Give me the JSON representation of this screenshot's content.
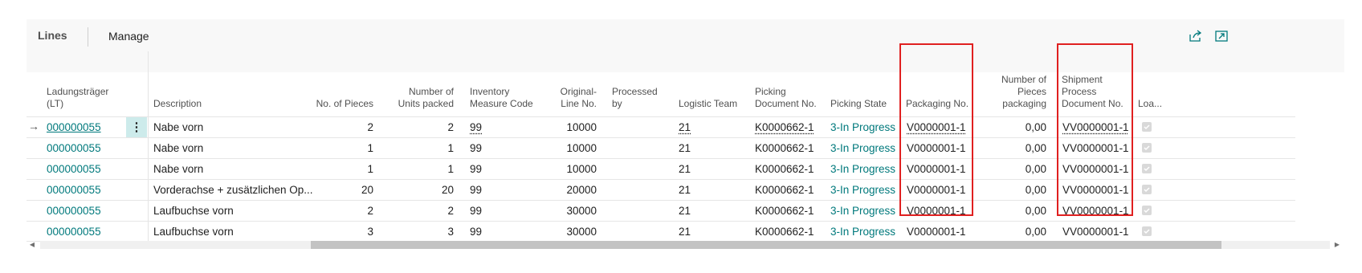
{
  "header": {
    "title": "Lines",
    "manage_label": "Manage",
    "share_icon": "share-icon",
    "expand_icon": "expand-icon"
  },
  "columns": {
    "lt": "Ladungsträger (LT)",
    "description": "Description",
    "no_pieces": "No. of Pieces",
    "units_packed": "Number of Units packed",
    "inv_measure": "Inventory Measure Code",
    "orig_line": "Original- Line No.",
    "processed_by": "Processed by",
    "logistic_team": "Logistic Team",
    "picking_doc": "Picking Document No.",
    "picking_state": "Picking State",
    "packaging_no": "Packaging No.",
    "pieces_packaging": "Number of Pieces packaging",
    "shipment_doc": "Shipment Process Document No.",
    "loaded": "Loa..."
  },
  "rows": [
    {
      "lt": "000000055",
      "description": "Nabe vorn",
      "no_pieces": "2",
      "units_packed": "2",
      "inv_measure": "99",
      "orig_line": "10000",
      "processed_by": "",
      "logistic_team": "21",
      "picking_doc": "K0000662-1",
      "picking_state": "3-In Progress",
      "packaging_no": "V0000001-1",
      "pieces_packaging": "0,00",
      "shipment_doc": "VV0000001-1",
      "loaded": true
    },
    {
      "lt": "000000055",
      "description": "Nabe vorn",
      "no_pieces": "1",
      "units_packed": "1",
      "inv_measure": "99",
      "orig_line": "10000",
      "processed_by": "",
      "logistic_team": "21",
      "picking_doc": "K0000662-1",
      "picking_state": "3-In Progress",
      "packaging_no": "V0000001-1",
      "pieces_packaging": "0,00",
      "shipment_doc": "VV0000001-1",
      "loaded": true
    },
    {
      "lt": "000000055",
      "description": "Nabe vorn",
      "no_pieces": "1",
      "units_packed": "1",
      "inv_measure": "99",
      "orig_line": "10000",
      "processed_by": "",
      "logistic_team": "21",
      "picking_doc": "K0000662-1",
      "picking_state": "3-In Progress",
      "packaging_no": "V0000001-1",
      "pieces_packaging": "0,00",
      "shipment_doc": "VV0000001-1",
      "loaded": true
    },
    {
      "lt": "000000055",
      "description": "Vorderachse + zusätzlichen Op...",
      "no_pieces": "20",
      "units_packed": "20",
      "inv_measure": "99",
      "orig_line": "20000",
      "processed_by": "",
      "logistic_team": "21",
      "picking_doc": "K0000662-1",
      "picking_state": "3-In Progress",
      "packaging_no": "V0000001-1",
      "pieces_packaging": "0,00",
      "shipment_doc": "VV0000001-1",
      "loaded": true
    },
    {
      "lt": "000000055",
      "description": "Laufbuchse vorn",
      "no_pieces": "2",
      "units_packed": "2",
      "inv_measure": "99",
      "orig_line": "30000",
      "processed_by": "",
      "logistic_team": "21",
      "picking_doc": "K0000662-1",
      "picking_state": "3-In Progress",
      "packaging_no": "V0000001-1",
      "pieces_packaging": "0,00",
      "shipment_doc": "VV0000001-1",
      "loaded": true
    },
    {
      "lt": "000000055",
      "description": "Laufbuchse vorn",
      "no_pieces": "3",
      "units_packed": "3",
      "inv_measure": "99",
      "orig_line": "30000",
      "processed_by": "",
      "logistic_team": "21",
      "picking_doc": "K0000662-1",
      "picking_state": "3-In Progress",
      "packaging_no": "V0000001-1",
      "pieces_packaging": "0,00",
      "shipment_doc": "VV0000001-1",
      "loaded": true
    }
  ],
  "selected_row": {
    "arrow": "→",
    "menu": "⋮"
  },
  "colors": {
    "link": "#00797c",
    "highlight": "#e02020",
    "selected": "#cdebeb"
  }
}
